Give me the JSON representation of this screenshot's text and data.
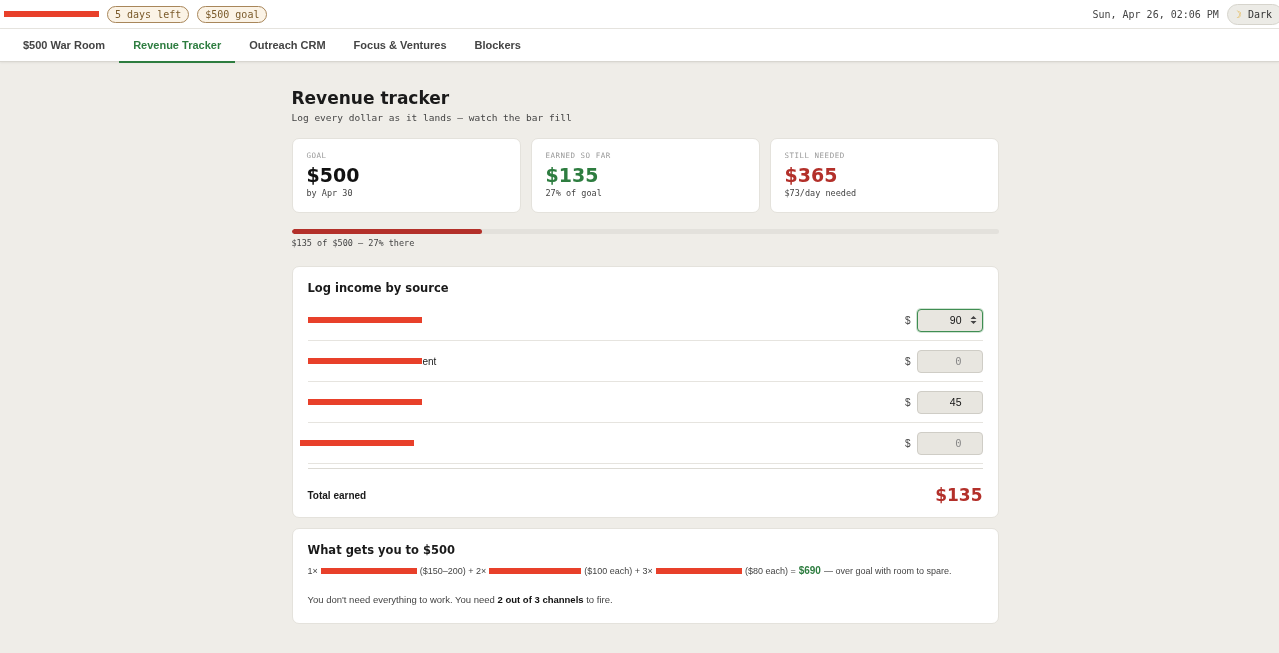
{
  "header": {
    "logo": {
      "kind": "redacted"
    },
    "badges": [
      "5 days left",
      "$500 goal"
    ],
    "datetime": "Sun, Apr 26, 02:06 PM",
    "theme_toggle": {
      "label": "Dark",
      "icon": "☽"
    }
  },
  "tabs": [
    {
      "label": "$500 War Room",
      "selected": false
    },
    {
      "label": "Revenue Tracker",
      "selected": true
    },
    {
      "label": "Outreach CRM",
      "selected": false
    },
    {
      "label": "Focus & Ventures",
      "selected": false
    },
    {
      "label": "Blockers",
      "selected": false
    }
  ],
  "page": {
    "title": "Revenue tracker",
    "subtitle": "Log every dollar as it lands — watch the bar fill"
  },
  "stats": [
    {
      "label": "GOAL",
      "value": "$500",
      "note": "by Apr 30",
      "color": "#111111"
    },
    {
      "label": "EARNED SO FAR",
      "value": "$135",
      "note": "27% of goal",
      "color": "#2e7d40"
    },
    {
      "label": "STILL NEEDED",
      "value": "$365",
      "note": "$73/day needed",
      "color": "#b3302a"
    }
  ],
  "progress": {
    "level": 0.27,
    "caption": "$135 of $500 — 27% there"
  },
  "income": {
    "title": "Log income by source",
    "currency": "$",
    "rows": [
      {
        "label_tail": "",
        "value": "90",
        "placeholder": "",
        "focused": true
      },
      {
        "label_tail": "ent",
        "value": "",
        "placeholder": "0",
        "focused": false
      },
      {
        "label_tail": "",
        "value": "45",
        "placeholder": "",
        "focused": false
      },
      {
        "label_tail": "",
        "value": "",
        "placeholder": "0",
        "focused": false
      }
    ],
    "total_label": "Total earned",
    "total_value": "$135"
  },
  "plan": {
    "title": "What gets you to $500",
    "parts": [
      {
        "kind": "text",
        "text": "1×"
      },
      {
        "kind": "redacted"
      },
      {
        "kind": "text",
        "text": "($150–200) + 2×"
      },
      {
        "kind": "redacted"
      },
      {
        "kind": "text",
        "text": "($100 each) + 3×"
      },
      {
        "kind": "redacted"
      },
      {
        "kind": "text",
        "text": "($80 each) ="
      },
      {
        "kind": "highlight",
        "text": "$690"
      },
      {
        "kind": "text",
        "text": "— over goal with room to spare."
      }
    ],
    "note": "You don't need everything to work. You need **2 out of 3 channels** to fire."
  }
}
